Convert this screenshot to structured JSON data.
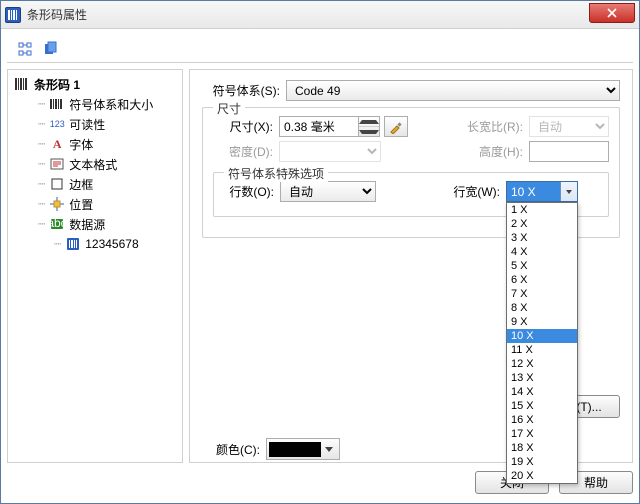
{
  "window": {
    "title": "条形码属性"
  },
  "tree": {
    "root": "条形码 1",
    "items": [
      {
        "icon": "barcode",
        "label": "符号体系和大小"
      },
      {
        "icon": "readability",
        "label": "可读性"
      },
      {
        "icon": "font",
        "label": "字体"
      },
      {
        "icon": "textformat",
        "label": "文本格式"
      },
      {
        "icon": "border",
        "label": "边框"
      },
      {
        "icon": "position",
        "label": "位置"
      },
      {
        "icon": "datasource",
        "label": "数据源"
      }
    ],
    "data_value": "12345678"
  },
  "panel": {
    "symbology_label": "符号体系(S):",
    "symbology_value": "Code 49",
    "size_group": "尺寸",
    "size_label": "尺寸(X):",
    "size_value": "0.38 毫米",
    "density_label": "密度(D):",
    "ratio_label": "长宽比(R):",
    "ratio_value": "自动",
    "height_label": "高度(H):",
    "special_group": "符号体系特殊选项",
    "rows_label": "行数(O):",
    "rows_value": "自动",
    "rowwidth_label": "行宽(W):",
    "rowwidth_value": "10 X",
    "rowwidth_options": [
      "1 X",
      "2 X",
      "3 X",
      "4 X",
      "5 X",
      "6 X",
      "7 X",
      "8 X",
      "9 X",
      "10 X",
      "11 X",
      "12 X",
      "13 X",
      "14 X",
      "15 X",
      "16 X",
      "17 X",
      "18 X",
      "19 X",
      "20 X"
    ],
    "rowwidth_selected_index": 9,
    "color_label": "颜色(C):",
    "sample_button": "式(T)..."
  },
  "footer": {
    "close": "关闭",
    "help": "帮助"
  }
}
